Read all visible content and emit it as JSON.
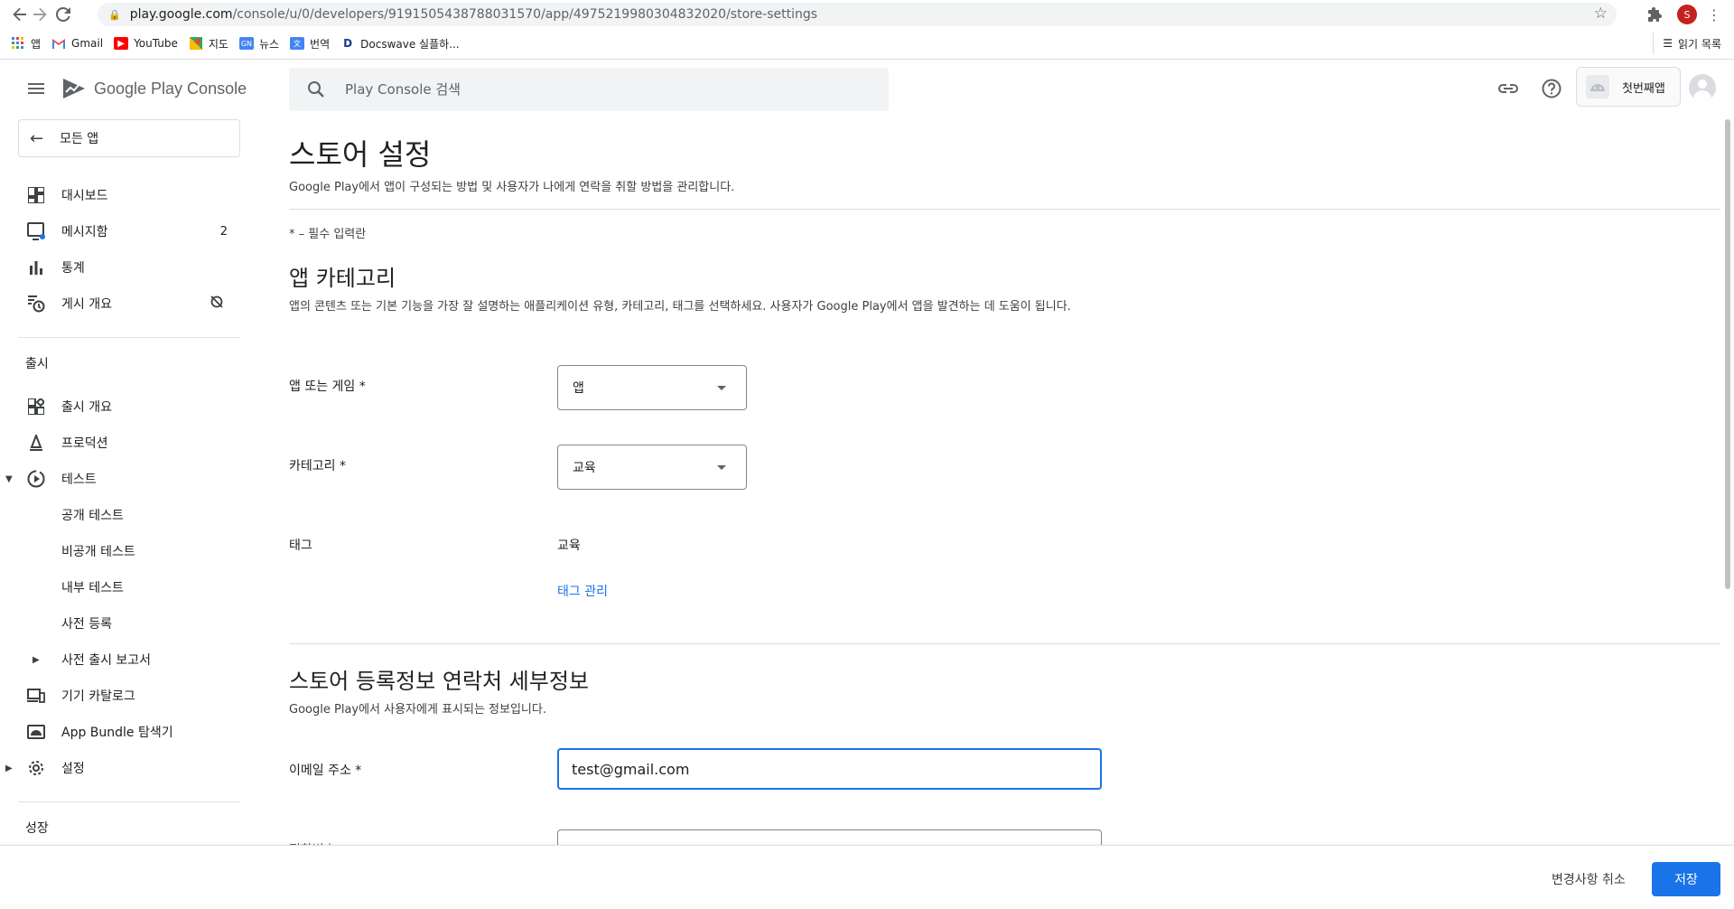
{
  "browser": {
    "url_domain": "play.google.com",
    "url_path": "/console/u/0/developers/9191505438788031570/app/4975219980304832020/store-settings",
    "profile_initial": "S",
    "bookmarks": [
      {
        "label": "앱",
        "icon": "apps-grid-icon",
        "color": "#4285f4"
      },
      {
        "label": "Gmail",
        "icon": "gmail-icon",
        "color": "#ea4335"
      },
      {
        "label": "YouTube",
        "icon": "youtube-icon",
        "color": "#ff0000"
      },
      {
        "label": "지도",
        "icon": "maps-icon",
        "color": "#34a853"
      },
      {
        "label": "뉴스",
        "icon": "news-icon",
        "color": "#4285f4"
      },
      {
        "label": "번역",
        "icon": "translate-icon",
        "color": "#4285f4"
      },
      {
        "label": "Docswave 실플하...",
        "icon": "docswave-icon",
        "color": "#1a3c8f"
      }
    ],
    "reading_list": "읽기 목록"
  },
  "header": {
    "brand": "Google Play Console",
    "search_placeholder": "Play Console 검색",
    "app_name": "첫번째앱"
  },
  "sidebar": {
    "back_label": "모든 앱",
    "items": [
      {
        "label": "대시보드",
        "icon": "dashboard-icon"
      },
      {
        "label": "메시지함",
        "icon": "inbox-icon",
        "badge": "2"
      },
      {
        "label": "통계",
        "icon": "bar-chart-icon"
      },
      {
        "label": "게시 개요",
        "icon": "publishing-overview-icon",
        "status_icon": "sync-disabled-icon"
      }
    ],
    "section_release": "출시",
    "release_items": [
      {
        "label": "출시 개요",
        "icon": "release-overview-icon"
      },
      {
        "label": "프로덕션",
        "icon": "production-icon"
      },
      {
        "label": "테스트",
        "icon": "testing-icon"
      },
      {
        "label": "공개 테스트"
      },
      {
        "label": "비공개 테스트"
      },
      {
        "label": "내부 테스트"
      },
      {
        "label": "사전 등록"
      },
      {
        "label": "사전 출시 보고서"
      },
      {
        "label": "기기 카탈로그",
        "icon": "device-catalog-icon"
      },
      {
        "label": "App Bundle 탐색기",
        "icon": "app-bundle-icon"
      },
      {
        "label": "설정",
        "icon": "settings-gear-icon"
      }
    ],
    "section_grow": "성장"
  },
  "main": {
    "title": "스토어 설정",
    "subtitle": "Google Play에서 앱이 구성되는 방법 및 사용자가 나에게 연락을 취할 방법을 관리합니다.",
    "required_note": "* – 필수 입력란",
    "category_section": {
      "title": "앱 카테고리",
      "desc": "앱의 콘텐츠 또는 기본 기능을 가장 잘 설명하는 애플리케이션 유형, 카테고리, 태그를 선택하세요. 사용자가 Google Play에서 앱을 발견하는 데 도움이 됩니다.",
      "app_or_game_label": "앱 또는 게임 *",
      "app_or_game_value": "앱",
      "category_label": "카테고리 *",
      "category_value": "교육",
      "tags_label": "태그",
      "tags_value": "교육",
      "manage_tags": "태그 관리"
    },
    "contact_section": {
      "title": "스토어 등록정보 연락처 세부정보",
      "desc": "Google Play에서 사용자에게 표시되는 정보입니다.",
      "email_label": "이메일 주소 *",
      "email_value": "test@gmail.com",
      "phone_label": "전화번호"
    }
  },
  "footer": {
    "discard": "변경사항 취소",
    "save": "저장"
  },
  "colors": {
    "accent": "#1a73e8",
    "text": "#202124",
    "muted": "#5f6368"
  }
}
